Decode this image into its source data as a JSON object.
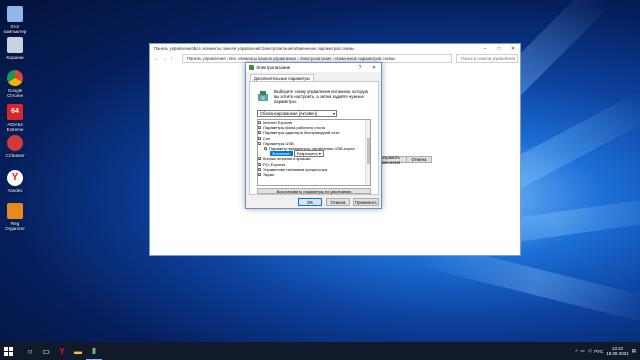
{
  "desktop": {
    "icons": [
      {
        "label": "Этот компьютер",
        "name": "this-pc-icon",
        "color": "#8fb7e8"
      },
      {
        "label": "Корзина",
        "name": "recycle-bin-icon",
        "color": "#c9d3df"
      },
      {
        "label": "Google Chrome",
        "name": "chrome-icon",
        "color": "#e8c44a"
      },
      {
        "label": "AIDA64 Extreme",
        "name": "aida64-icon",
        "color": "#d62828"
      },
      {
        "label": "CCleaner",
        "name": "ccleaner-icon",
        "color": "#cf3b3b"
      },
      {
        "label": "Yandex",
        "name": "yandex-icon",
        "color": "#e31b1b"
      },
      {
        "label": "Reg Organizer",
        "name": "reg-organizer-icon",
        "color": "#e48a1f"
      }
    ]
  },
  "explorer": {
    "title": "Панель управления\\Все элементы панели управления\\Электропитание\\Изменение параметров схемы",
    "breadcrumb": [
      "Панель управления",
      "Все элементы панели управления",
      "Электропитание",
      "Изменение параметров схемы"
    ],
    "search_placeholder": "Поиск в панели управления",
    "save_label": "Сохранить изменения",
    "cancel_label": "Отмена"
  },
  "dialog": {
    "title": "Электропитание",
    "tab": "Дополнительные параметры",
    "description": "Выберите схему управления питанием, которую вы хотите настроить, а затем задайте нужные параметры.",
    "scheme": "Сбалансированная [Активен]",
    "tree": [
      {
        "label": "Internet Explorer",
        "sign": "+",
        "indent": 0
      },
      {
        "label": "Параметры фона рабочего стола",
        "sign": "+",
        "indent": 0
      },
      {
        "label": "Параметры адаптера беспроводной сети",
        "sign": "+",
        "indent": 0
      },
      {
        "label": "Сон",
        "sign": "+",
        "indent": 0
      },
      {
        "label": "Параметры USB",
        "sign": "−",
        "indent": 0
      },
      {
        "label": "Параметр временного отключения USB-порта",
        "sign": "−",
        "indent": 1
      }
    ],
    "setting_label": "Значение:",
    "setting_value": "Разрешено",
    "tree_after": [
      {
        "label": "Кнопки питания и крышка",
        "sign": "+"
      },
      {
        "label": "PCI Express",
        "sign": "+"
      },
      {
        "label": "Управление питанием процессора",
        "sign": "+"
      },
      {
        "label": "Экран",
        "sign": "+"
      }
    ],
    "restore_label": "Восстановить параметры по умолчанию",
    "ok_label": "ОК",
    "cancel_label": "Отмена",
    "apply_label": "Применить"
  },
  "taskbar": {
    "lang": "РУС",
    "time": "13:22",
    "date": "18.08.2021"
  }
}
